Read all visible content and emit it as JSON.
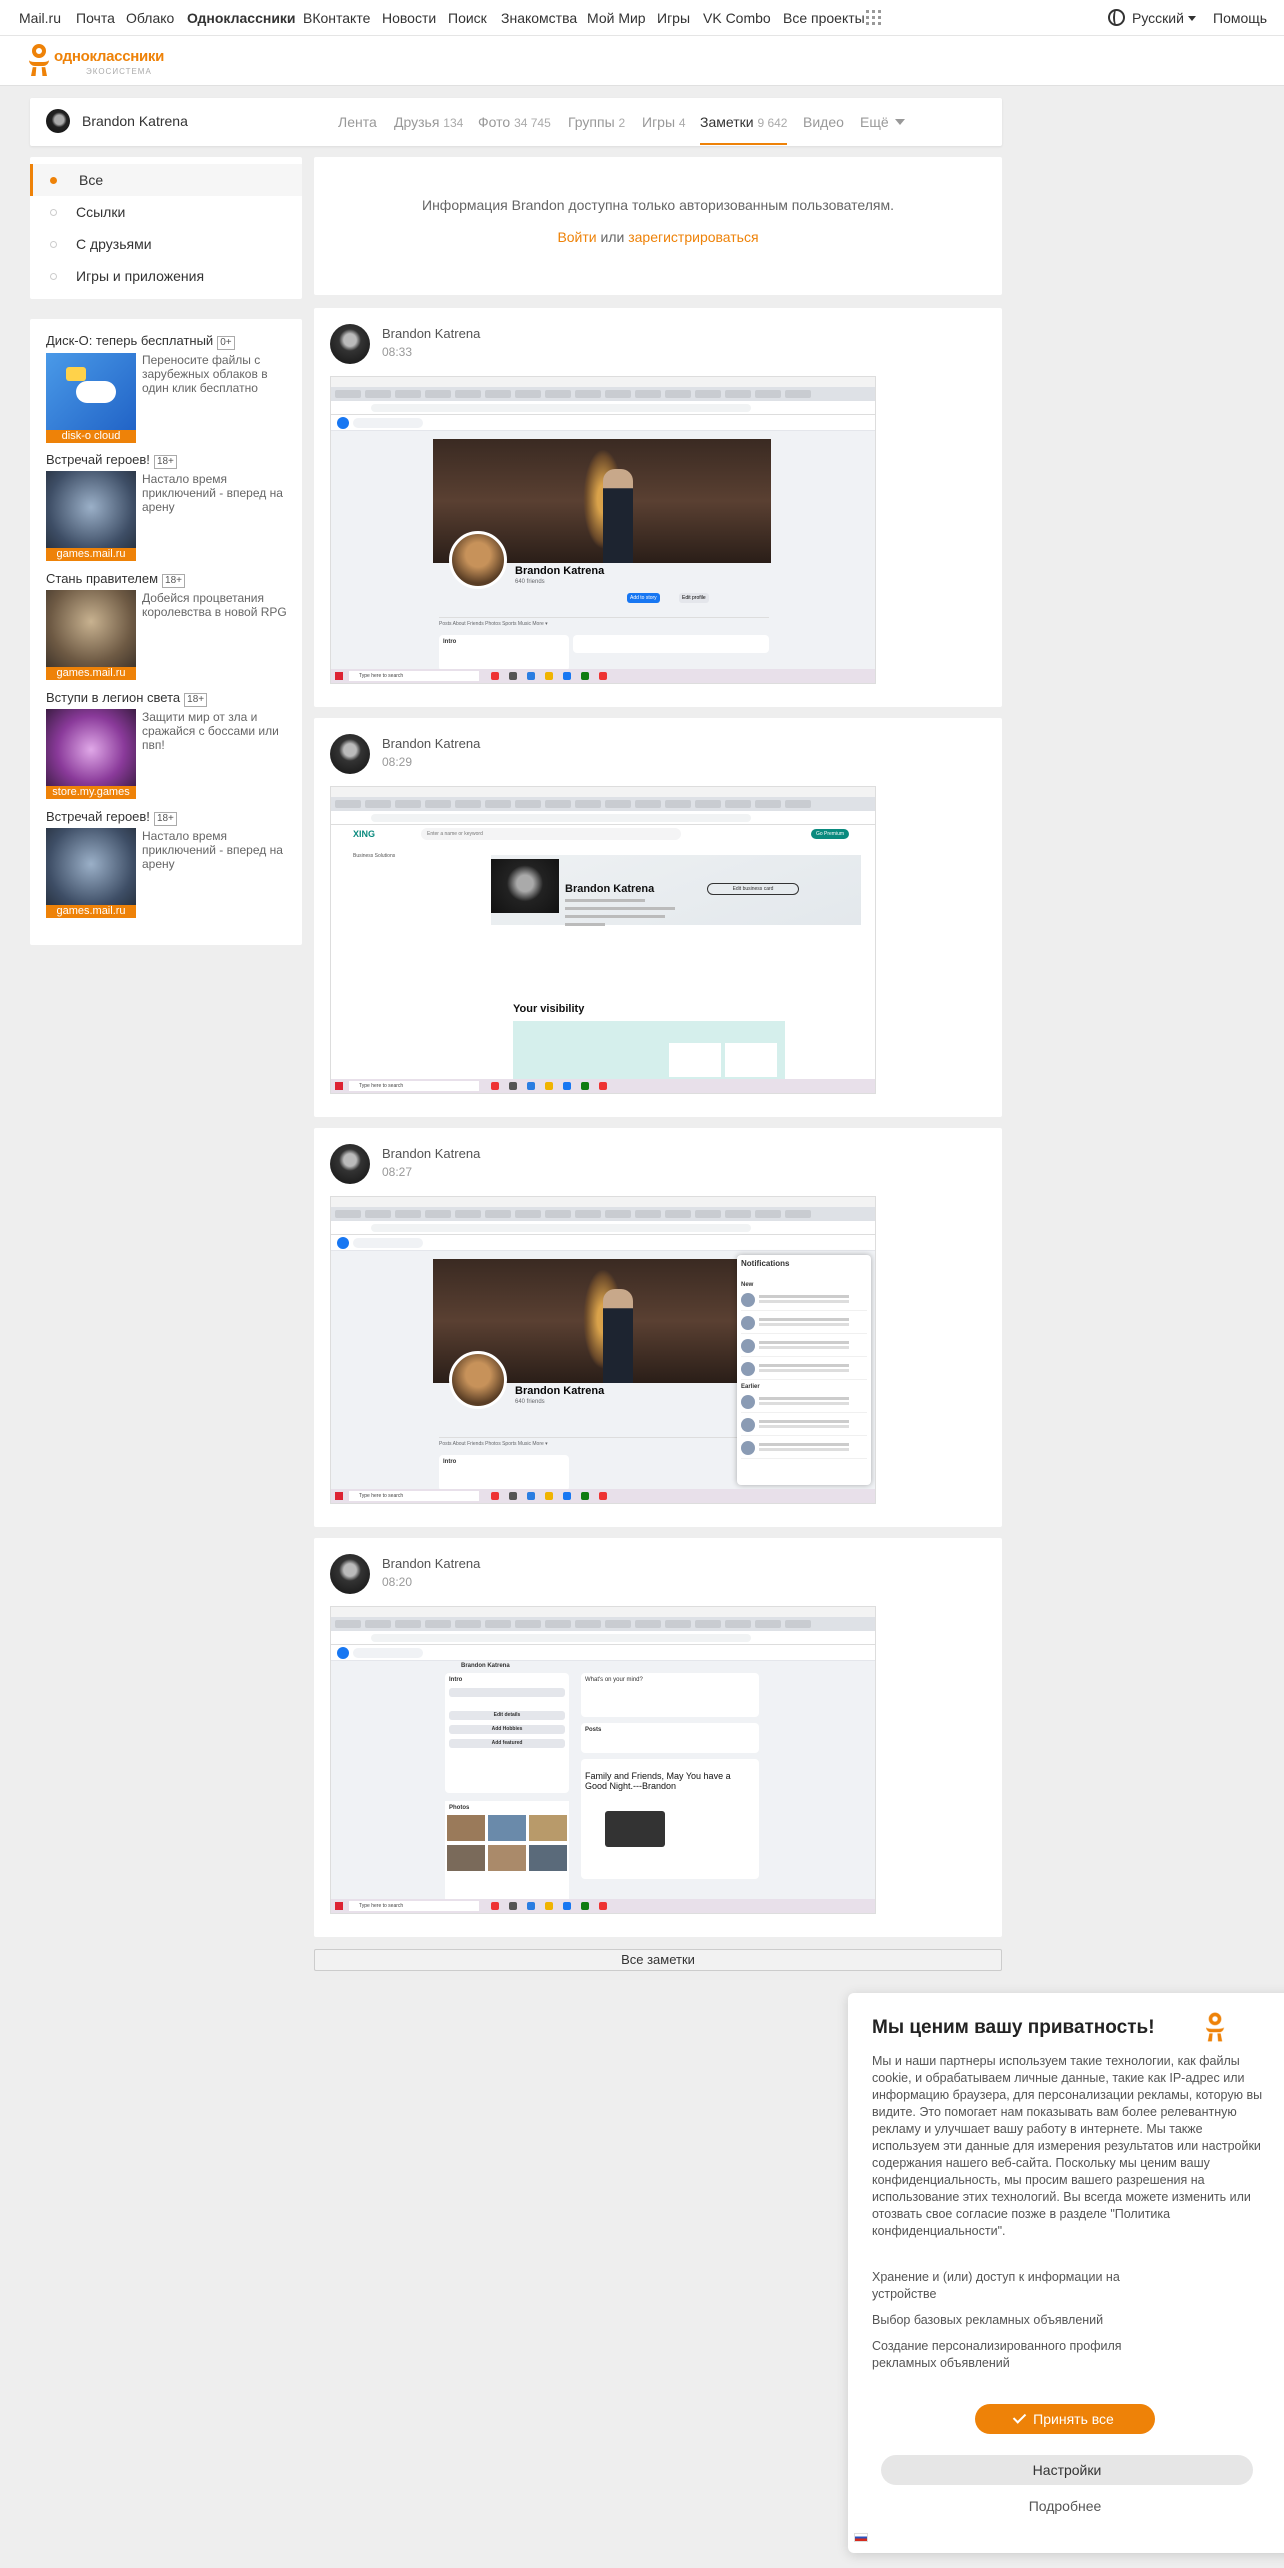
{
  "topnav": {
    "items": [
      "Mail.ru",
      "Почта",
      "Облако",
      "Одноклассники",
      "ВКонтакте",
      "Новости",
      "Поиск",
      "Знакомства",
      "Мой Мир",
      "Игры",
      "VK Combo",
      "Все проекты"
    ],
    "language": "Русский",
    "help": "Помощь"
  },
  "logo": {
    "text": "одноклассники",
    "sub": "экосистема"
  },
  "profile": {
    "name": "Brandon Katrena",
    "tabs": [
      {
        "label": "Лента",
        "count": ""
      },
      {
        "label": "Друзья",
        "count": "134"
      },
      {
        "label": "Фото",
        "count": "34 745"
      },
      {
        "label": "Группы",
        "count": "2"
      },
      {
        "label": "Игры",
        "count": "4"
      },
      {
        "label": "Заметки",
        "count": "9 642"
      },
      {
        "label": "Видео",
        "count": ""
      },
      {
        "label": "Ещё",
        "count": ""
      }
    ],
    "active_tab": "Заметки"
  },
  "leftnav": {
    "items": [
      "Все",
      "Ссылки",
      "С друзьями",
      "Игры и приложения"
    ],
    "active": "Все"
  },
  "ads": [
    {
      "title": "Диск-О: теперь бесплатный",
      "age": "0+",
      "label": "disk-o cloud",
      "text": "Переносите файлы с зарубежных облаков в один клик бесплатно"
    },
    {
      "title": "Встречай героев!",
      "age": "18+",
      "label": "games.mail.ru",
      "text": "Настало время приключений - вперед на арену"
    },
    {
      "title": "Стань правителем",
      "age": "18+",
      "label": "games.mail.ru",
      "text": "Добейся процветания королевства в новой RPG"
    },
    {
      "title": "Вступи в легион света",
      "age": "18+",
      "label": "store.my.games",
      "text": "Защити мир от зла и сражайся с боссами или пвп!"
    },
    {
      "title": "Встречай героев!",
      "age": "18+",
      "label": "games.mail.ru",
      "text": "Настало время приключений - вперед на арену"
    }
  ],
  "info": {
    "text": "Информация Brandon доступна только авторизованным пользователям.",
    "login": "Войти",
    "or": "или",
    "register": "зарегистрироваться"
  },
  "posts": [
    {
      "author": "Brandon Katrena",
      "time": "08:33",
      "shot": {
        "name": "Brandon Katrena",
        "friends": "640 friends",
        "tabs": "Posts   About   Friends   Photos   Sports   Music   More ▾",
        "intro": "Intro",
        "add_story": "Add to story",
        "edit_profile": "Edit profile",
        "search": "Type here to search"
      }
    },
    {
      "author": "Brandon Katrena",
      "time": "08:29",
      "shot": {
        "logo": "XING",
        "search": "Type here to search",
        "field": "Enter a name or keyword",
        "premium": "Go Premium",
        "name": "Brandon Katrena",
        "card": "Edit business card",
        "visibility": "Your visibility",
        "side": "Business Solutions"
      }
    },
    {
      "author": "Brandon Katrena",
      "time": "08:27",
      "shot": {
        "name": "Brandon Katrena",
        "friends": "640 friends",
        "tabs": "Posts   About   Friends   Photos   Sports   Music   More ▾",
        "intro": "Intro",
        "notifications": "Notifications",
        "new": "New",
        "earlier": "Earlier",
        "search": "Type here to search"
      }
    },
    {
      "author": "Brandon Katrena",
      "time": "08:20",
      "shot": {
        "name": "Brandon Katrena",
        "intro": "Intro",
        "edit_details": "Edit details",
        "add_hobbies": "Add Hobbies",
        "add_featured": "Add featured",
        "photos": "Photos",
        "posts": "Posts",
        "post_text": "Family and Friends, May You have a Good Night.---Brandon",
        "search": "Type here to search",
        "whats": "What's on your mind?"
      }
    }
  ],
  "all_notes": "Все заметки",
  "privacy": {
    "title": "Мы ценим вашу приватность!",
    "body": "Мы и наши партнеры используем такие технологии, как файлы cookie, и обрабатываем личные данные, такие как IP-адрес или информацию браузера, для персонализации рекламы, которую вы видите. Это помогает нам показывать вам более релевантную рекламу и улучшает вашу работу в интернете. Мы также используем эти данные для измерения результатов или настройки содержания нашего веб-сайта. Поскольку мы ценим вашу конфиденциальность, мы просим вашего разрешения на использование этих технологий. Вы всегда можете изменить или отозвать свое согласие позже в разделе \"Политика конфиденциальности\".",
    "items": [
      "Хранение и (или) доступ к информации на устройстве",
      "Выбор базовых рекламных объявлений",
      "Создание персонализированного профиля рекламных объявлений"
    ],
    "accept": "Принять все",
    "settings": "Настройки",
    "more": "Подробнее"
  },
  "colors": {
    "accent": "#ee8208",
    "facebook": "#1877f2",
    "xing": "#0a8a7e",
    "background": "#eeeeee"
  }
}
